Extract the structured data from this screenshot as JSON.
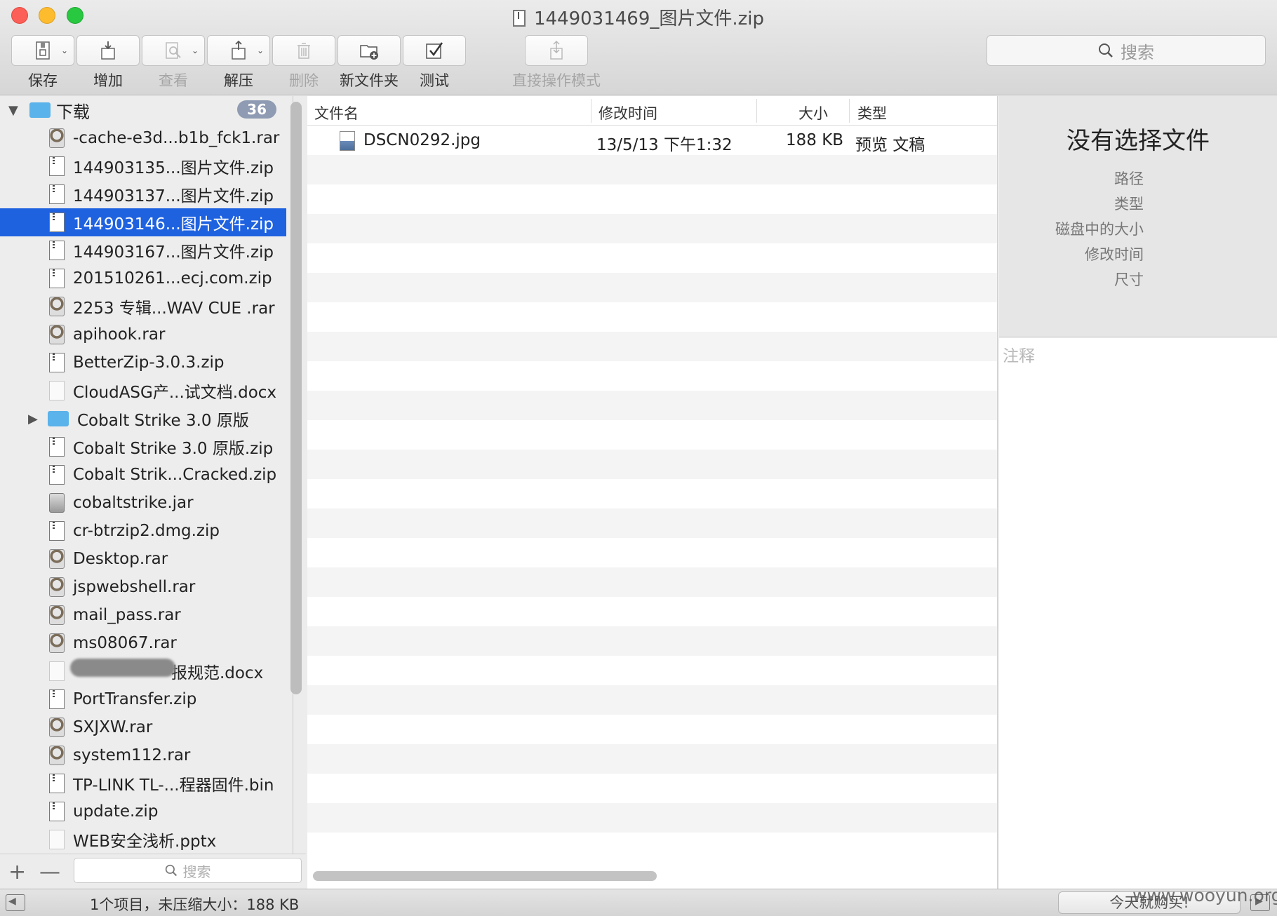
{
  "window": {
    "title": "1449031469_图片文件.zip"
  },
  "toolbar": {
    "save": "保存",
    "add": "增加",
    "view": "查看",
    "extract": "解压",
    "delete": "删除",
    "new_folder": "新文件夹",
    "test": "测试",
    "direct_mode": "直接操作模式",
    "search_placeholder": "搜索"
  },
  "sidebar": {
    "root": {
      "label": "下载",
      "count": "36"
    },
    "items": [
      {
        "label": "-cache-e3d...b1b_fck1.rar",
        "icon": "rar-icon"
      },
      {
        "label": "144903135...图片文件.zip",
        "icon": "zip-icon"
      },
      {
        "label": "144903137...图片文件.zip",
        "icon": "zip-icon"
      },
      {
        "label": "144903146...图片文件.zip",
        "icon": "zip-icon",
        "selected": true
      },
      {
        "label": "144903167...图片文件.zip",
        "icon": "zip-icon"
      },
      {
        "label": "201510261...ecj.com.zip",
        "icon": "zip-icon"
      },
      {
        "label": "2253 专辑...WAV CUE .rar",
        "icon": "rar-icon"
      },
      {
        "label": "apihook.rar",
        "icon": "rar-icon"
      },
      {
        "label": "BetterZip-3.0.3.zip",
        "icon": "zip-icon"
      },
      {
        "label": "CloudASG产...试文档.docx",
        "icon": "document-icon"
      },
      {
        "label": "Cobalt Strike 3.0 原版",
        "icon": "folder-icon"
      },
      {
        "label": "Cobalt Strike 3.0 原版.zip",
        "icon": "zip-icon"
      },
      {
        "label": "Cobalt Strik...Cracked.zip",
        "icon": "zip-icon"
      },
      {
        "label": "cobaltstrike.jar",
        "icon": "jar-icon"
      },
      {
        "label": "cr-btrzip2.dmg.zip",
        "icon": "zip-icon"
      },
      {
        "label": "Desktop.rar",
        "icon": "rar-icon"
      },
      {
        "label": "jspwebshell.rar",
        "icon": "rar-icon"
      },
      {
        "label": "mail_pass.rar",
        "icon": "rar-icon"
      },
      {
        "label": "ms08067.rar",
        "icon": "rar-icon"
      },
      {
        "label": "报规范.docx",
        "icon": "document-icon"
      },
      {
        "label": "PortTransfer.zip",
        "icon": "zip-icon"
      },
      {
        "label": "SXJXW.rar",
        "icon": "rar-icon"
      },
      {
        "label": "system112.rar",
        "icon": "rar-icon"
      },
      {
        "label": "TP-LINK TL-...程器固件.bin",
        "icon": "zip-icon"
      },
      {
        "label": "update.zip",
        "icon": "zip-icon"
      },
      {
        "label": "WEB安全浅析.pptx",
        "icon": "document-icon"
      }
    ],
    "search_placeholder": "搜索",
    "add_symbol": "+",
    "remove_symbol": "—"
  },
  "file_list": {
    "columns": {
      "name": "文件名",
      "modified": "修改时间",
      "size": "大小",
      "type": "类型"
    },
    "rows": [
      {
        "name": "DSCN0292.jpg",
        "modified": "13/5/13 下午1:32",
        "size": "188 KB",
        "type": "预览 文稿"
      }
    ]
  },
  "info_panel": {
    "title": "没有选择文件",
    "props": [
      "路径",
      "类型",
      "磁盘中的大小",
      "修改时间",
      "尺寸"
    ],
    "notes_placeholder": "注释"
  },
  "statusbar": {
    "text": "1个项目，未压缩大小：188 KB",
    "buy_label": "今天就购买!",
    "watermark": "www.wooyun.org"
  },
  "colors": {
    "selection": "#1e62e0",
    "folder": "#5ab3ea",
    "badge": "#8f9bb2"
  }
}
